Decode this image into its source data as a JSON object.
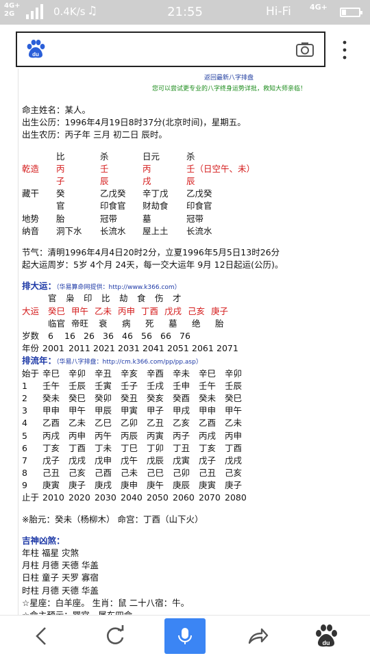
{
  "status": {
    "net_top": "4G+",
    "net_bottom": "2G",
    "speed": "0.4K/s",
    "music": "♫",
    "time": "21:55",
    "wifi": "Hi-Fi",
    "net_right": "4G+"
  },
  "icons": [
    "baidu-logo-icon",
    "camera-icon",
    "more-vertical-icon",
    "back-icon",
    "refresh-icon",
    "microphone-icon",
    "share-icon",
    "baidu-paw-icon"
  ],
  "header": {
    "top_link": "返回最新八字排盘",
    "promo": "您可以尝试更专业的八字终身运势详批，救知大师亲临！"
  },
  "info": {
    "name": "命主姓名：某人。",
    "solar": "出生公历：1996年4月19日8时37分(北京时间)，星期五。",
    "lunar": "出生农历：丙子年 三月 初二日 辰时。"
  },
  "pillars": {
    "header": [
      "比",
      "杀",
      "日元",
      "杀"
    ],
    "qian_label": "乾造",
    "stems": [
      "丙",
      "壬",
      "丙",
      "壬（日空午、未）"
    ],
    "branches": [
      "子",
      "辰",
      "戌",
      "辰"
    ],
    "canggan_label": "藏干",
    "canggan": [
      "癸",
      "乙戊癸",
      "辛丁戊",
      "乙戊癸"
    ],
    "shishen": [
      "官",
      "印食官",
      "财劫食",
      "印食官"
    ],
    "dishi_label": "地势",
    "dishi": [
      "胎",
      "冠带",
      "墓",
      "冠带"
    ],
    "nayin_label": "纳音",
    "nayin": [
      "洞下水",
      "长流水",
      "屋上土",
      "长流水"
    ]
  },
  "jieqi": {
    "line1": "节气：清明1996年4月4日20时2分，立夏1996年5月5日13时26分",
    "line2": "起大运周岁：5岁 4个月 24天，每一交大运年 9月 12日起运(公历)。"
  },
  "dayun": {
    "title": "排大运：",
    "source": "（华易算命网提供：http://www.k366.com）",
    "top": [
      "官",
      "枭",
      "印",
      "比",
      "劫",
      "食",
      "伤",
      "才"
    ],
    "label": "大运",
    "pillars": [
      "癸巳",
      "甲午",
      "乙未",
      "丙申",
      "丁酉",
      "戊戌",
      "己亥",
      "庚子"
    ],
    "states": [
      "临官",
      "帝旺",
      "衰",
      "病",
      "死",
      "墓",
      "绝",
      "胎"
    ],
    "age_label": "岁数",
    "ages": [
      "6",
      "16",
      "26",
      "36",
      "46",
      "56",
      "66",
      "76"
    ],
    "year_label": "年份",
    "years": [
      "2001",
      "2011",
      "2021",
      "2031",
      "2041",
      "2051",
      "2061",
      "2071"
    ]
  },
  "liunian": {
    "title": "排流年：",
    "source": "（华易八字排盘：http://cm.k366.com/pp/pp.asp）",
    "start_label": "始于",
    "start": [
      "辛巳",
      "辛卯",
      "辛丑",
      "辛亥",
      "辛酉",
      "辛未",
      "辛巳",
      "辛卯"
    ],
    "rows": [
      {
        "n": "1",
        "v": [
          "壬午",
          "壬辰",
          "壬寅",
          "壬子",
          "壬戌",
          "壬申",
          "壬午",
          "壬辰"
        ]
      },
      {
        "n": "2",
        "v": [
          "癸未",
          "癸巳",
          "癸卯",
          "癸丑",
          "癸亥",
          "癸酉",
          "癸未",
          "癸巳"
        ]
      },
      {
        "n": "3",
        "v": [
          "甲申",
          "甲午",
          "甲辰",
          "甲寅",
          "甲子",
          "甲戌",
          "甲申",
          "甲午"
        ]
      },
      {
        "n": "4",
        "v": [
          "乙酉",
          "乙未",
          "乙巳",
          "乙卯",
          "乙丑",
          "乙亥",
          "乙酉",
          "乙未"
        ]
      },
      {
        "n": "5",
        "v": [
          "丙戌",
          "丙申",
          "丙午",
          "丙辰",
          "丙寅",
          "丙子",
          "丙戌",
          "丙申"
        ]
      },
      {
        "n": "6",
        "v": [
          "丁亥",
          "丁酉",
          "丁未",
          "丁巳",
          "丁卯",
          "丁丑",
          "丁亥",
          "丁酉"
        ]
      },
      {
        "n": "7",
        "v": [
          "戊子",
          "戊戌",
          "戊申",
          "戊午",
          "戊辰",
          "戊寅",
          "戊子",
          "戊戌"
        ]
      },
      {
        "n": "8",
        "v": [
          "己丑",
          "己亥",
          "己酉",
          "己未",
          "己巳",
          "己卯",
          "己丑",
          "己亥"
        ]
      },
      {
        "n": "9",
        "v": [
          "庚寅",
          "庚子",
          "庚戌",
          "庚申",
          "庚午",
          "庚辰",
          "庚寅",
          "庚子"
        ]
      }
    ],
    "end_label": "止于",
    "end": [
      "2010",
      "2020",
      "2030",
      "2040",
      "2050",
      "2060",
      "2070",
      "2080"
    ]
  },
  "taiyuan": "※胎元：癸未（杨柳木）    命宫：丁酉（山下火）",
  "jishen": {
    "title": "吉神凶煞：",
    "lines": [
      "年柱 福星 灾煞",
      "月柱 月德 天德 华盖",
      "日柱 童子 天罗 寡宿",
      "时柱 月德 天德 华盖"
    ]
  },
  "star": "☆星座：白羊座。  生肖：鼠 二十八宿：牛。",
  "minggua": "☆命主预示：巽宫，属东四命。"
}
